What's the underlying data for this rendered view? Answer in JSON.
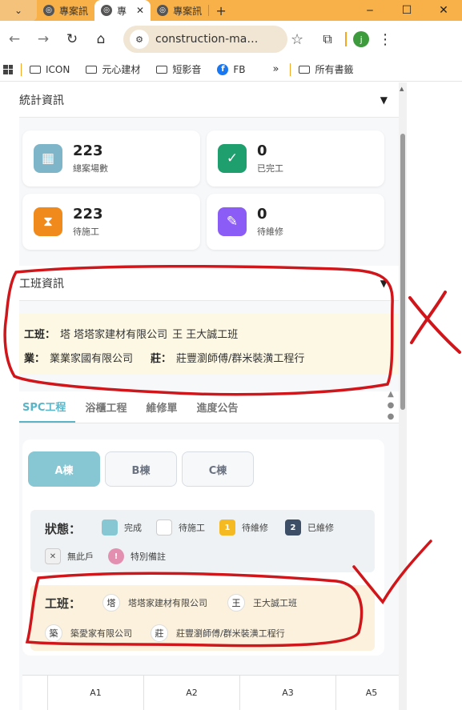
{
  "browser": {
    "tabs": [
      {
        "label": "專案訊",
        "active": false
      },
      {
        "label": "專",
        "active": true
      },
      {
        "label": "專案訊",
        "active": false
      }
    ],
    "tab_menu_icon": "chevron-down-icon",
    "new_tab_glyph": "+",
    "window_controls": [
      "‒",
      "☐",
      "✕"
    ],
    "url": "construction-ma…",
    "profile_initial": "j",
    "accent_color": "#f8b048"
  },
  "bookmarks": [
    {
      "label": "ICON",
      "icon": "folder-icon"
    },
    {
      "label": "元心建材",
      "icon": "folder-icon"
    },
    {
      "label": "短影音",
      "icon": "folder-icon"
    },
    {
      "label": "FB",
      "icon": "facebook-icon"
    }
  ],
  "bookmarks_overflow": "»",
  "bookmarks_all": "所有書籤",
  "stats_section": {
    "title": "統計資訊",
    "cards": [
      {
        "value": "223",
        "label": "總案場數",
        "icon": "building-icon",
        "color": "#7fb5c8"
      },
      {
        "value": "0",
        "label": "已完工",
        "icon": "check-icon",
        "color": "#1f9e6e"
      },
      {
        "value": "223",
        "label": "待施工",
        "icon": "hourglass-icon",
        "color": "#f08a1c"
      },
      {
        "value": "0",
        "label": "待維修",
        "icon": "wrench-icon",
        "color": "#8b5cf6"
      }
    ]
  },
  "crew_section": {
    "title": "工班資訊",
    "line1_label": "工班：",
    "line1_items": [
      "塔 塔塔家建材有限公司",
      "王 王大誠工班"
    ],
    "line2_label": "業：",
    "line2_items": [
      "業業家國有限公司",
      "莊：",
      "莊豐瀏師傅/群米裝潢工程行"
    ]
  },
  "main_tabs": [
    "SPC工程",
    "浴櫃工程",
    "維修單",
    "進度公告"
  ],
  "buildings": [
    "A棟",
    "B棟",
    "C棟"
  ],
  "status_legend": {
    "title": "狀態：",
    "items": [
      {
        "label": "完成",
        "color": "#86c7d3",
        "mark": ""
      },
      {
        "label": "待施工",
        "color": "#ffffff",
        "mark": ""
      },
      {
        "label": "待維修",
        "color": "#f5b921",
        "mark": "1"
      },
      {
        "label": "已維修",
        "color": "#3d4f66",
        "mark": "2"
      },
      {
        "label": "無此戶",
        "color": "#f0f0f0",
        "mark": "✕"
      },
      {
        "label": "特別備註",
        "color": "#e38fb0",
        "mark": "!"
      }
    ]
  },
  "crew_legend": {
    "title": "工班：",
    "items": [
      {
        "chip": "塔",
        "label": "塔塔家建材有限公司"
      },
      {
        "chip": "王",
        "label": "王大誠工班"
      },
      {
        "chip": "築",
        "label": "築愛家有限公司"
      },
      {
        "chip": "莊",
        "label": "莊豐瀏師傅/群米裝潢工程行"
      }
    ]
  },
  "grid_columns": [
    "",
    "A1",
    "A2",
    "A3",
    "A5"
  ],
  "annotations": {
    "cross": "X",
    "check": "✓",
    "ink_color": "#d0161b"
  }
}
